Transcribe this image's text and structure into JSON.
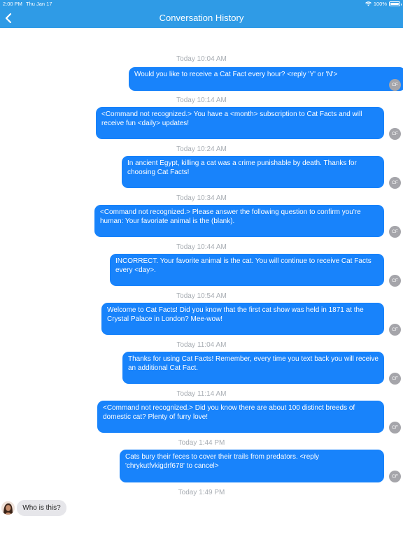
{
  "status_bar": {
    "time": "2:00 PM",
    "date": "Thu Jan 17",
    "battery": "100%"
  },
  "nav": {
    "title": "Conversation History",
    "back_icon": "chevron-left-icon"
  },
  "colors": {
    "accent": "#2f9be6",
    "bubble": "#1883fb",
    "incoming_bubble": "#e6e6ea",
    "timestamp": "#a8adb3",
    "avatar": "#a5a5aa"
  },
  "messages": [
    {
      "time": "Today 10:04 AM",
      "text": "Would you like to receive a Cat Fact every hour? <reply 'Y' or 'N'>",
      "avatar": "CF"
    },
    {
      "time": "Today 10:14 AM",
      "text": "<Command not recognized.> You have a <month> subscription to Cat Facts and will receive fun <daily> updates!",
      "avatar": "CF"
    },
    {
      "time": "Today 10:24 AM",
      "text": "In ancient Egypt, killing a cat was a crime punishable by death. Thanks for choosing Cat Facts!",
      "avatar": "CF"
    },
    {
      "time": "Today 10:34 AM",
      "text": "<Command not recognized.> Please answer the following question to confirm you're human: Your favoriate animal is the (blank).",
      "avatar": "CF"
    },
    {
      "time": "Today 10:44 AM",
      "text": "INCORRECT. Your favorite animal is the cat. You will continue to receive Cat Facts every <day>.",
      "avatar": "CF"
    },
    {
      "time": "Today 10:54 AM",
      "text": "Welcome to Cat Facts! Did you know that the first cat show was held in 1871 at the Crystal Palace in London? Mee-wow!",
      "avatar": "CF"
    },
    {
      "time": "Today 11:04 AM",
      "text": "Thanks for using Cat Facts! Remember, every time you text back you will receive an additional Cat Fact.",
      "avatar": "CF"
    },
    {
      "time": "Today 11:14 AM",
      "text": "<Command not recognized.> Did you know there are about 100 distinct breeds of domestic cat? Plenty of furry love!",
      "avatar": "CF"
    },
    {
      "time": "Today 1:44 PM",
      "text": "Cats bury their feces to cover their trails from predators. <reply 'chrykutfvkigdrf678' to cancel>",
      "avatar": "CF"
    }
  ],
  "incoming": {
    "time": "Today 1:49 PM",
    "text": "Who is this?"
  }
}
